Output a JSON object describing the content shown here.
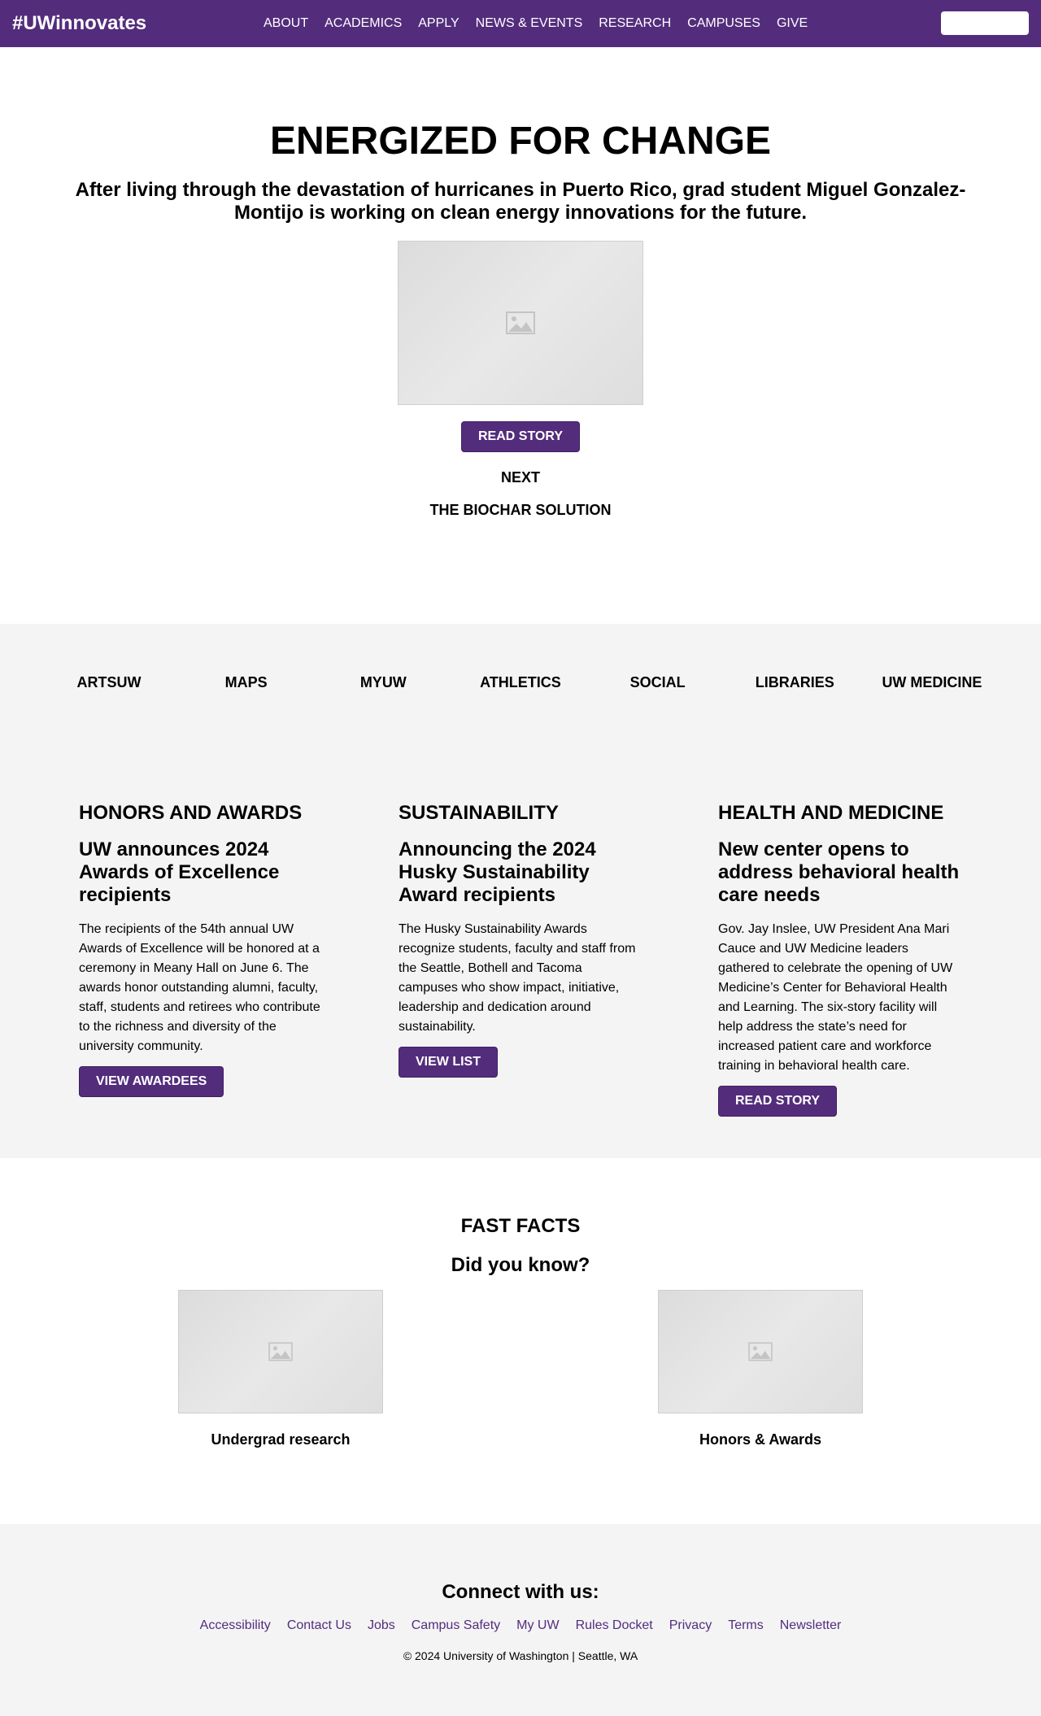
{
  "brand": {
    "title": "#UWinnovates"
  },
  "nav": {
    "items": [
      "ABOUT",
      "ACADEMICS",
      "APPLY",
      "NEWS & EVENTS",
      "RESEARCH",
      "CAMPUSES",
      "GIVE"
    ]
  },
  "search": {
    "value": ""
  },
  "hero": {
    "title": "ENERGIZED FOR CHANGE",
    "lede": "After living through the devastation of hurricanes in Puerto Rico, grad student Miguel Gonzalez-Montijo is working on clean energy innovations for the future.",
    "button": "READ STORY",
    "next_label": "NEXT",
    "next_title": "THE BIOCHAR SOLUTION"
  },
  "quicklinks": [
    "ARTSUW",
    "MAPS",
    "MYUW",
    "ATHLETICS",
    "SOCIAL",
    "LIBRARIES",
    "UW MEDICINE"
  ],
  "cards": [
    {
      "category": "HONORS AND AWARDS",
      "headline": "UW announces 2024 Awards of Excellence recipients",
      "body": "The recipients of the 54th annual UW Awards of Excellence will be honored at a ceremony in Meany Hall on June 6. The awards honor outstanding alumni, faculty, staff, students and retirees who contribute to the richness and diversity of the university community.",
      "button": "VIEW AWARDEES"
    },
    {
      "category": "SUSTAINABILITY",
      "headline": "Announcing the 2024 Husky Sustainability Award recipients",
      "body": "The Husky Sustainability Awards recognize students, faculty and staff from the Seattle, Bothell and Tacoma campuses who show impact, initiative, leadership and dedication around sustainability.",
      "button": "VIEW LIST"
    },
    {
      "category": "HEALTH AND MEDICINE",
      "headline": "New center opens to address behavioral health care needs",
      "body": "Gov. Jay Inslee, UW President Ana Mari Cauce and UW Medicine leaders gathered to celebrate the opening of UW Medicine’s Center for Behavioral Health and Learning. The six-story facility will help address the state’s need for increased patient care and workforce training in behavioral health care.",
      "button": "READ STORY"
    }
  ],
  "facts": {
    "heading": "FAST FACTS",
    "sub": "Did you know?",
    "items": [
      "Undergrad research",
      "Honors & Awards"
    ]
  },
  "footer": {
    "connect": "Connect with us:",
    "links": [
      "Accessibility",
      "Contact Us",
      "Jobs",
      "Campus Safety",
      "My UW",
      "Rules Docket",
      "Privacy",
      "Terms",
      "Newsletter"
    ],
    "copyright": "© 2024 University of Washington | Seattle, WA"
  },
  "colors": {
    "brand_purple": "#532d7c",
    "section_gray": "#f4f4f5"
  },
  "icons": {
    "image_placeholder": "image-placeholder-icon"
  }
}
